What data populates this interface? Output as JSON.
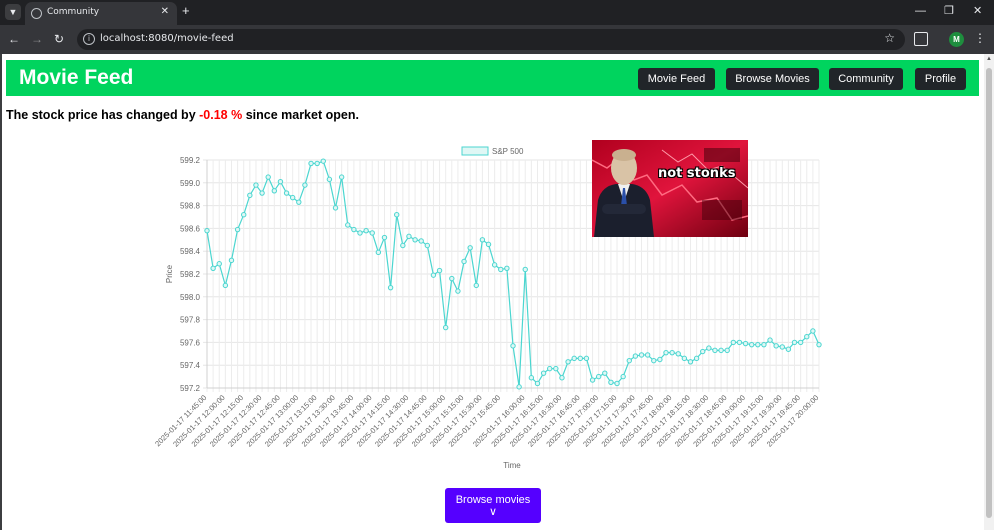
{
  "browser": {
    "tab_title": "Community",
    "url": "localhost:8080/movie-feed",
    "profile_initial": "M"
  },
  "header": {
    "title": "Movie Feed",
    "nav": [
      "Movie Feed",
      "Browse Movies",
      "Community",
      "Profile"
    ]
  },
  "ticker": {
    "prefix": "The stock price has changed by ",
    "change": "-0.18 %",
    "suffix": " since market open."
  },
  "meme": {
    "caption": "not stonks"
  },
  "browse_button": {
    "label": "Browse movies"
  },
  "colors": {
    "header_bg": "#00d45e",
    "line": "#4bd6d0",
    "negative": "#ff0000",
    "button": "#5500ff"
  },
  "chart_data": {
    "type": "line",
    "legend": "S&P 500",
    "xlabel": "Time",
    "ylabel": "Price",
    "ylim": [
      597.2,
      599.2
    ],
    "y_ticks": [
      "599.2",
      "599.0",
      "598.8",
      "598.6",
      "598.4",
      "598.2",
      "598.0",
      "597.8",
      "597.6",
      "597.4",
      "597.2"
    ],
    "x_tick_labels": [
      "2025-01-17 11:45:00",
      "2025-01-17 12:00:00",
      "2025-01-17 12:15:00",
      "2025-01-17 12:30:00",
      "2025-01-17 12:45:00",
      "2025-01-17 13:00:00",
      "2025-01-17 13:15:00",
      "2025-01-17 13:30:00",
      "2025-01-17 13:45:00",
      "2025-01-17 14:00:00",
      "2025-01-17 14:15:00",
      "2025-01-17 14:30:00",
      "2025-01-17 14:45:00",
      "2025-01-17 15:00:00",
      "2025-01-17 15:15:00",
      "2025-01-17 15:30:00",
      "2025-01-17 15:45:00",
      "2025-01-17 16:00:00",
      "2025-01-17 16:15:00",
      "2025-01-17 16:30:00",
      "2025-01-17 16:45:00",
      "2025-01-17 17:00:00",
      "2025-01-17 17:15:00",
      "2025-01-17 17:30:00",
      "2025-01-17 17:45:00",
      "2025-01-17 18:00:00",
      "2025-01-17 18:15:00",
      "2025-01-17 18:30:00",
      "2025-01-17 18:45:00",
      "2025-01-17 19:00:00",
      "2025-01-17 19:15:00",
      "2025-01-17 19:30:00",
      "2025-01-17 19:45:00",
      "2025-01-17 20:00:00"
    ],
    "values": [
      598.58,
      598.25,
      598.29,
      598.1,
      598.32,
      598.59,
      598.72,
      598.89,
      598.98,
      598.91,
      599.05,
      598.93,
      599.01,
      598.91,
      598.87,
      598.83,
      598.98,
      599.17,
      599.17,
      599.19,
      599.03,
      598.78,
      599.05,
      598.63,
      598.59,
      598.56,
      598.58,
      598.56,
      598.39,
      598.52,
      598.08,
      598.72,
      598.45,
      598.53,
      598.5,
      598.49,
      598.45,
      598.19,
      598.23,
      597.73,
      598.16,
      598.05,
      598.31,
      598.43,
      598.1,
      598.5,
      598.46,
      598.28,
      598.24,
      598.25,
      597.57,
      597.21,
      598.24,
      597.29,
      597.24,
      597.33,
      597.37,
      597.37,
      597.29,
      597.43,
      597.46,
      597.46,
      597.46,
      597.27,
      597.3,
      597.33,
      597.25,
      597.24,
      597.3,
      597.44,
      597.48,
      597.49,
      597.49,
      597.44,
      597.45,
      597.51,
      597.51,
      597.5,
      597.46,
      597.43,
      597.46,
      597.52,
      597.55,
      597.53,
      597.53,
      597.53,
      597.6,
      597.6,
      597.59,
      597.58,
      597.58,
      597.58,
      597.62,
      597.57,
      597.56,
      597.54,
      597.6,
      597.6,
      597.65,
      597.7,
      597.58
    ]
  }
}
